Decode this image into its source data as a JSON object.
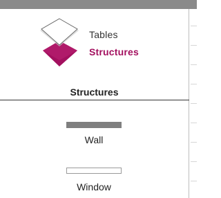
{
  "layer_switcher": {
    "top_label": "Tables",
    "bottom_label": "Structures",
    "active": "Structures",
    "colors": {
      "inactive_fill": "#ffffff",
      "active_fill": "#a3105f",
      "active_text": "#a3105f"
    }
  },
  "section": {
    "title": "Structures"
  },
  "tools": [
    {
      "label": "Wall",
      "swatch_color": "#7f7f7f"
    },
    {
      "label": "Window",
      "swatch_color": "#ffffff"
    }
  ]
}
